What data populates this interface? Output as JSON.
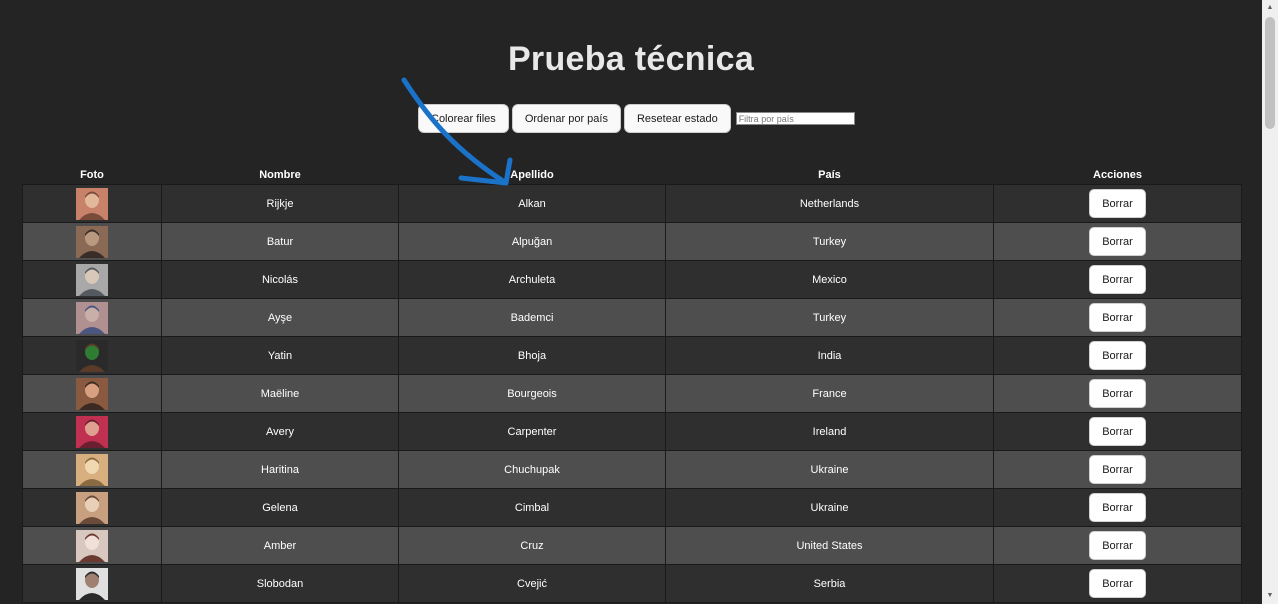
{
  "page": {
    "title": "Prueba técnica"
  },
  "controls": {
    "color_rows_label": "Colorear files",
    "sort_country_label": "Ordenar por país",
    "reset_label": "Resetear estado",
    "filter_placeholder": "Filtra por país"
  },
  "table": {
    "headers": [
      "Foto",
      "Nombre",
      "Apellido",
      "País",
      "Acciones"
    ],
    "delete_label": "Borrar",
    "rows": [
      {
        "first": "Rijkje",
        "last": "Alkan",
        "country": "Netherlands"
      },
      {
        "first": "Batur",
        "last": "Alpuğan",
        "country": "Turkey"
      },
      {
        "first": "Nicolás",
        "last": "Archuleta",
        "country": "Mexico"
      },
      {
        "first": "Ayşe",
        "last": "Bademci",
        "country": "Turkey"
      },
      {
        "first": "Yatin",
        "last": "Bhoja",
        "country": "India"
      },
      {
        "first": "Maëline",
        "last": "Bourgeois",
        "country": "France"
      },
      {
        "first": "Avery",
        "last": "Carpenter",
        "country": "Ireland"
      },
      {
        "first": "Haritina",
        "last": "Chuchupak",
        "country": "Ukraine"
      },
      {
        "first": "Gelena",
        "last": "Cimbal",
        "country": "Ukraine"
      },
      {
        "first": "Amber",
        "last": "Cruz",
        "country": "United States"
      },
      {
        "first": "Slobodan",
        "last": "Cvejić",
        "country": "Serbia"
      }
    ]
  },
  "annotation": {
    "arrow_color": "#1a73c8"
  },
  "colors": {
    "background": "#242424",
    "row_dark": "#2f2f2f",
    "row_light": "#4e4e4e"
  }
}
